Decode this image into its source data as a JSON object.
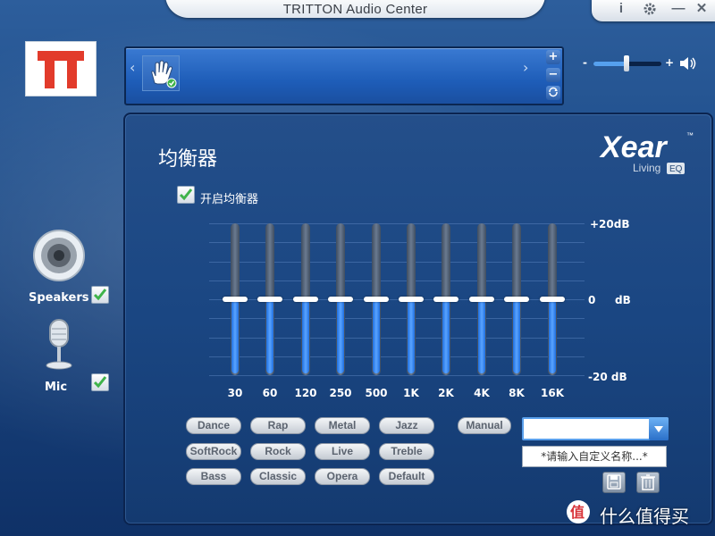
{
  "window": {
    "title": "TRITTON Audio Center",
    "buttons": {
      "info": "i",
      "settings_icon": "gear-icon",
      "minimize": "—",
      "close": "✕"
    }
  },
  "profile_bar": {
    "prev_icon": "chevron-left-icon",
    "next_icon": "chevron-right-icon",
    "profile_icon": "hand-icon",
    "add": "+",
    "remove": "−",
    "refresh_icon": "refresh-icon"
  },
  "volume": {
    "minus": "-",
    "plus": "+",
    "level": 0.5,
    "icon": "speaker-volume-icon"
  },
  "devices": [
    {
      "label": "Speakers",
      "icon": "speaker-icon",
      "checked": true
    },
    {
      "label": "Mic",
      "icon": "microphone-icon",
      "checked": true
    }
  ],
  "eq": {
    "title": "均衡器",
    "brand": {
      "name": "Xear",
      "tm": "™",
      "sub": "Living",
      "tag": "EQ"
    },
    "enable_label": "开启均衡器",
    "enabled": true,
    "db_labels": {
      "top": "+20dB",
      "mid_value": "0",
      "mid_unit": "dB",
      "bottom": "-20 dB"
    },
    "bands": [
      {
        "freq": "30",
        "gain_db": 0
      },
      {
        "freq": "60",
        "gain_db": 0
      },
      {
        "freq": "120",
        "gain_db": 0
      },
      {
        "freq": "250",
        "gain_db": 0
      },
      {
        "freq": "500",
        "gain_db": 0
      },
      {
        "freq": "1K",
        "gain_db": 0
      },
      {
        "freq": "2K",
        "gain_db": 0
      },
      {
        "freq": "4K",
        "gain_db": 0
      },
      {
        "freq": "8K",
        "gain_db": 0
      },
      {
        "freq": "16K",
        "gain_db": 0
      }
    ],
    "presets": [
      [
        "Dance",
        "Rap",
        "Metal",
        "Jazz"
      ],
      [
        "SoftRock",
        "Rock",
        "Live",
        "Treble"
      ],
      [
        "Bass",
        "Classic",
        "Opera",
        "Default"
      ]
    ],
    "manual_label": "Manual",
    "custom_name_placeholder": "*请输入自定义名称...*",
    "save_icon": "save-icon",
    "delete_icon": "trash-icon"
  },
  "watermark": {
    "text": "什么值得买",
    "icon": "smzdm-logo-icon"
  },
  "colors": {
    "accent": "#56a0ee",
    "slider_fill": "#3a8cf0",
    "logo_red": "#e23b2b"
  }
}
